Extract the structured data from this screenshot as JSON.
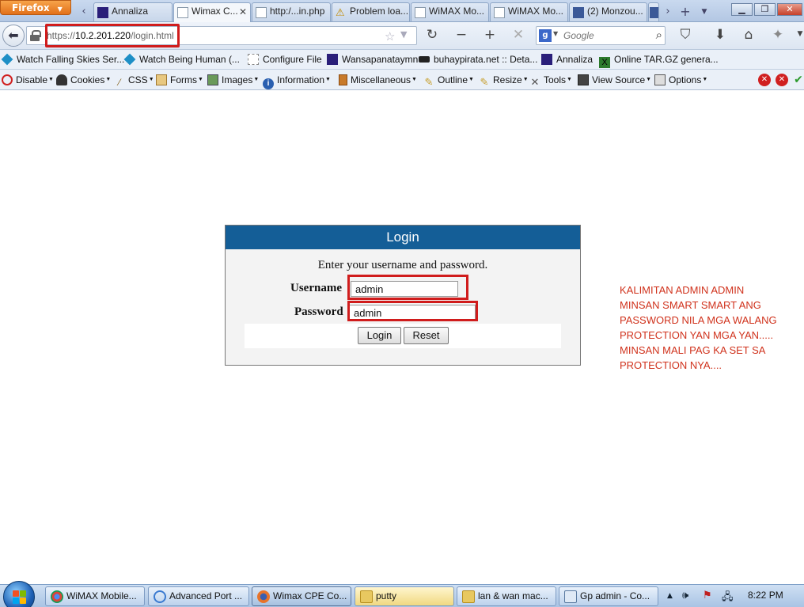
{
  "browser": {
    "menu_button": "Firefox",
    "tabs": [
      {
        "title": "Annaliza",
        "active": false
      },
      {
        "title": "Wimax C...",
        "active": true
      },
      {
        "title": "http:/...in.php",
        "active": false
      },
      {
        "title": "Problem loa...",
        "active": false
      },
      {
        "title": "WiMAX Mo...",
        "active": false
      },
      {
        "title": "WiMAX Mo...",
        "active": false
      },
      {
        "title": "(2) Monzou...",
        "active": false
      }
    ]
  },
  "navbar": {
    "url_scheme": "https://",
    "url_host": "10.2.201.220",
    "url_path": "/login.html",
    "search_placeholder": "Google"
  },
  "bookmarks": [
    {
      "label": "Watch Falling Skies Ser...",
      "icon": "cube-icon",
      "color": "#1e8fc6"
    },
    {
      "label": "Watch Being Human (...",
      "icon": "cube-icon",
      "color": "#1e8fc6"
    },
    {
      "label": "Configure File",
      "icon": "page-icon",
      "color": "#ffffff"
    },
    {
      "label": "Wansapanataymn",
      "icon": "site-icon",
      "color": "#2a1f7a"
    },
    {
      "label": "buhaypirata.net :: Deta...",
      "icon": "pirate-icon",
      "color": "#222222"
    },
    {
      "label": "Annaliza",
      "icon": "site-icon",
      "color": "#2a1f7a"
    },
    {
      "label": "Online TAR.GZ genera...",
      "icon": "x-icon",
      "color": "#2c7a2c"
    }
  ],
  "devtoolbar": [
    {
      "label": "Disable",
      "icon": "disable-icon",
      "color": "#d02020"
    },
    {
      "label": "Cookies",
      "icon": "user-icon",
      "color": "#333333"
    },
    {
      "label": "CSS",
      "icon": "wand-icon",
      "color": "#8a6a2a"
    },
    {
      "label": "Forms",
      "icon": "form-icon",
      "color": "#c89a4a"
    },
    {
      "label": "Images",
      "icon": "image-icon",
      "color": "#4a7a4a"
    },
    {
      "label": "Information",
      "icon": "info-icon",
      "color": "#2a5fb0"
    },
    {
      "label": "Miscellaneous",
      "icon": "misc-icon",
      "color": "#c87a2a"
    },
    {
      "label": "Outline",
      "icon": "pencil-icon",
      "color": "#c8a030"
    },
    {
      "label": "Resize",
      "icon": "resize-icon",
      "color": "#c8a030"
    },
    {
      "label": "Tools",
      "icon": "tools-icon",
      "color": "#555555"
    },
    {
      "label": "View Source",
      "icon": "source-icon",
      "color": "#444444"
    },
    {
      "label": "Options",
      "icon": "options-icon",
      "color": "#555555"
    }
  ],
  "login": {
    "title": "Login",
    "prompt": "Enter your username and password.",
    "username_label": "Username",
    "username_value": "admin",
    "password_label": "Password",
    "password_value": "admin",
    "login_button": "Login",
    "reset_button": "Reset"
  },
  "annotation": {
    "lines": [
      "KALIMITAN ADMIN ADMIN",
      "MINSAN SMART SMART ANG",
      "PASSWORD NILA MGA WALANG",
      "PROTECTION YAN MGA YAN.....",
      "MINSAN MALI PAG KA SET SA",
      "PROTECTION NYA...."
    ]
  },
  "taskbar": {
    "items": [
      {
        "label": "WiMAX Mobile...",
        "icon": "chrome-icon"
      },
      {
        "label": "Advanced Port ...",
        "icon": "ie-icon"
      },
      {
        "label": "Wimax CPE Co...",
        "icon": "firefox-icon"
      },
      {
        "label": "putty",
        "icon": "folder-icon"
      },
      {
        "label": "lan & wan mac...",
        "icon": "folder-icon"
      },
      {
        "label": "Gp admin - Co...",
        "icon": "window-icon"
      }
    ],
    "clock": "8:22 PM"
  },
  "colors": {
    "login_header": "#145e97",
    "annotation_text": "#d0321c",
    "highlight_box": "#d01c1c"
  }
}
